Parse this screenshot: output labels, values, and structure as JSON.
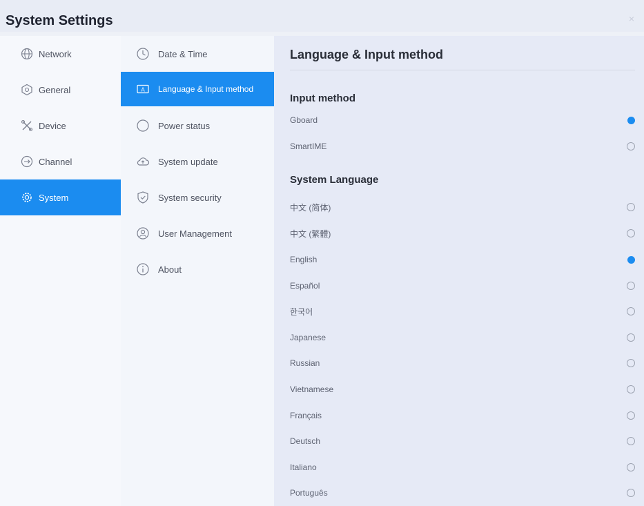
{
  "window": {
    "title": "System Settings",
    "close_glyph": "×"
  },
  "colors": {
    "accent": "#1b8cf0",
    "panel_bg": "#e6eaf6"
  },
  "categories": [
    {
      "label": "Network",
      "icon": "globe-icon",
      "active": false
    },
    {
      "label": "General",
      "icon": "general-icon",
      "active": false
    },
    {
      "label": "Device",
      "icon": "tools-icon",
      "active": false
    },
    {
      "label": "Channel",
      "icon": "channel-icon",
      "active": false
    },
    {
      "label": "System",
      "icon": "gear-icon",
      "active": true
    }
  ],
  "submenu": [
    {
      "label": "Date & Time",
      "icon": "clock-icon",
      "active": false
    },
    {
      "label": "Language & Input method",
      "icon": "keyboard-icon",
      "active": true
    },
    {
      "label": "Power status",
      "icon": "power-icon",
      "active": false
    },
    {
      "label": "System update",
      "icon": "cloud-update-icon",
      "active": false
    },
    {
      "label": "System security",
      "icon": "shield-icon",
      "active": false
    },
    {
      "label": "User Management",
      "icon": "user-icon",
      "active": false
    },
    {
      "label": "About",
      "icon": "info-icon",
      "active": false
    }
  ],
  "panel": {
    "title": "Language & Input method",
    "input_method": {
      "heading": "Input method",
      "options": [
        {
          "label": "Gboard",
          "selected": true
        },
        {
          "label": "SmartIME",
          "selected": false
        }
      ]
    },
    "system_language": {
      "heading": "System Language",
      "options": [
        {
          "label": "中文 (简体)",
          "selected": false
        },
        {
          "label": "中文 (繁體)",
          "selected": false
        },
        {
          "label": "English",
          "selected": true
        },
        {
          "label": "Español",
          "selected": false
        },
        {
          "label": "한국어",
          "selected": false
        },
        {
          "label": "Japanese",
          "selected": false
        },
        {
          "label": "Russian",
          "selected": false
        },
        {
          "label": "Vietnamese",
          "selected": false
        },
        {
          "label": "Français",
          "selected": false
        },
        {
          "label": "Deutsch",
          "selected": false
        },
        {
          "label": "Italiano",
          "selected": false
        },
        {
          "label": "Português",
          "selected": false
        }
      ]
    }
  }
}
